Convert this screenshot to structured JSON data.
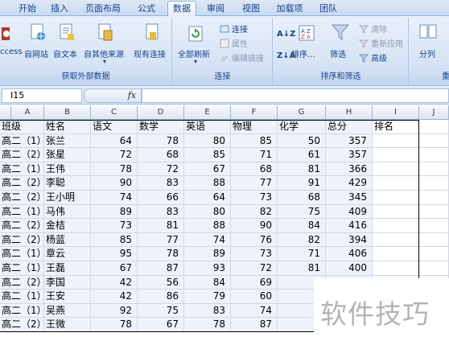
{
  "ribbon_tabs": [
    "开始",
    "插入",
    "页面布局",
    "公式",
    "数据",
    "审阅",
    "视图",
    "加载项",
    "团队"
  ],
  "active_tab": "数据",
  "groups": {
    "external": {
      "label": "获取外部数据",
      "access": "ccess",
      "web": "自网站",
      "text": "自文本",
      "other": "自其他来源",
      "existing": "现有连接"
    },
    "connections": {
      "label": "连接",
      "refresh_all": "全部刷新",
      "connections": "连接",
      "properties": "属性",
      "edit_links": "编辑链接"
    },
    "sort_filter": {
      "label": "排序和筛选",
      "sort": "排序...",
      "filter": "筛选",
      "clear": "清除",
      "reapply": "重新应用",
      "advanced": "高级"
    },
    "tools": {
      "split": "分列"
    }
  },
  "formula_bar": {
    "name_box": "I15",
    "fx": "fx",
    "value": ""
  },
  "columns": [
    "A",
    "B",
    "C",
    "D",
    "E",
    "F",
    "G",
    "H",
    "I",
    "J"
  ],
  "headers": [
    "班级",
    "姓名",
    "语文",
    "数学",
    "英语",
    "物理",
    "化学",
    "总分",
    "排名"
  ],
  "rows": [
    [
      "高二（1）",
      "张兰",
      "64",
      "78",
      "80",
      "85",
      "50",
      "357",
      ""
    ],
    [
      "高二（2）",
      "张星",
      "72",
      "68",
      "85",
      "71",
      "61",
      "357",
      ""
    ],
    [
      "高二（1）",
      "王伟",
      "78",
      "72",
      "67",
      "68",
      "81",
      "366",
      ""
    ],
    [
      "高二（2）",
      "李聪",
      "90",
      "83",
      "88",
      "77",
      "91",
      "429",
      ""
    ],
    [
      "高二（2）",
      "王小明",
      "74",
      "66",
      "64",
      "73",
      "68",
      "345",
      ""
    ],
    [
      "高二（1）",
      "马伟",
      "89",
      "83",
      "80",
      "82",
      "75",
      "409",
      ""
    ],
    [
      "高二（2）",
      "金桔",
      "73",
      "81",
      "88",
      "90",
      "84",
      "416",
      ""
    ],
    [
      "高二（2）",
      "杨蓝",
      "85",
      "77",
      "74",
      "76",
      "82",
      "394",
      ""
    ],
    [
      "高二（1）",
      "章云",
      "95",
      "78",
      "89",
      "73",
      "71",
      "406",
      ""
    ],
    [
      "高二（1）",
      "王磊",
      "67",
      "87",
      "93",
      "72",
      "81",
      "400",
      ""
    ],
    [
      "高二（2）",
      "李国",
      "42",
      "56",
      "84",
      "69",
      "",
      "",
      ""
    ],
    [
      "高二（1）",
      "王安",
      "42",
      "86",
      "79",
      "60",
      "",
      "",
      ""
    ],
    [
      "高二（1）",
      "吴燕",
      "92",
      "75",
      "83",
      "74",
      "",
      "",
      ""
    ],
    [
      "高二（2）",
      "王微",
      "78",
      "67",
      "78",
      "87",
      "",
      "",
      ""
    ]
  ],
  "watermark": "软件技巧"
}
